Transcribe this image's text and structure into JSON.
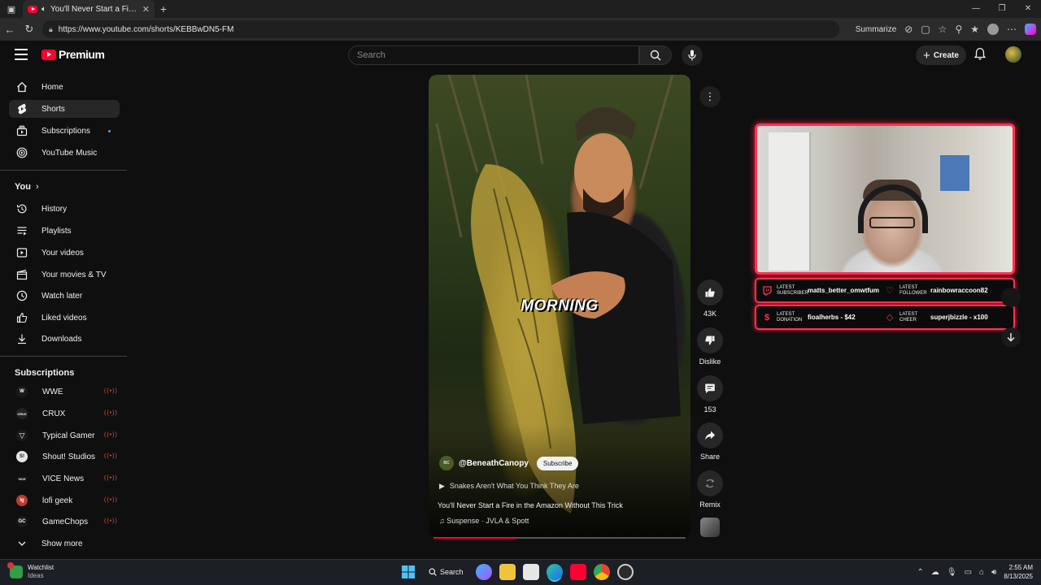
{
  "browser": {
    "tab_title": "You'll Never Start a Fire in th",
    "url": "https://www.youtube.com/shorts/KEBBwDN5-FM",
    "summarize_label": "Summarize"
  },
  "header": {
    "logo_text": "Premium",
    "search_placeholder": "Search",
    "create_label": "Create"
  },
  "sidebar": {
    "main": [
      {
        "label": "Home",
        "icon": "home-icon"
      },
      {
        "label": "Shorts",
        "icon": "shorts-icon",
        "active": true
      },
      {
        "label": "Subscriptions",
        "icon": "subscriptions-icon"
      },
      {
        "label": "YouTube Music",
        "icon": "youtube-music-icon"
      }
    ],
    "you_heading": "You",
    "you": [
      {
        "label": "History",
        "icon": "history-icon"
      },
      {
        "label": "Playlists",
        "icon": "playlists-icon"
      },
      {
        "label": "Your videos",
        "icon": "your-videos-icon"
      },
      {
        "label": "Your movies & TV",
        "icon": "movies-icon"
      },
      {
        "label": "Watch later",
        "icon": "watch-later-icon"
      },
      {
        "label": "Liked videos",
        "icon": "liked-icon"
      },
      {
        "label": "Downloads",
        "icon": "download-icon"
      }
    ],
    "subs_heading": "Subscriptions",
    "subs": [
      {
        "label": "WWE",
        "badge": "W",
        "color": "#1a1a1a"
      },
      {
        "label": "CRUX",
        "badge": "CRUX",
        "color": "#222222"
      },
      {
        "label": "Typical Gamer",
        "badge": "▽",
        "color": "#1a1a1a"
      },
      {
        "label": "Shout! Studios",
        "badge": "S!",
        "color": "#e6e6e6"
      },
      {
        "label": "VICE News",
        "badge": "VICE",
        "color": "#111111"
      },
      {
        "label": "lofi geek",
        "badge": "lg",
        "color": "#c0392b"
      },
      {
        "label": "GameChops",
        "badge": "GC",
        "color": "#1a1a1a"
      }
    ],
    "show_more": "Show more"
  },
  "short": {
    "caption": "MORNING",
    "channel": "@BeneathCanopy",
    "subscribe": "Subscribe",
    "playlist": "Snakes Aren't What You Think They Are",
    "title": "You'll Never Start a Fire in the Amazon Without This Trick",
    "sound": "Suspense · JVLA & Spott",
    "progress": 0.33,
    "likes": "43K",
    "dislike_label": "Dislike",
    "comments": "153",
    "share_label": "Share",
    "remix_label": "Remix"
  },
  "stream_overlay": {
    "accent": "#ff3150",
    "row1": [
      {
        "key1": "LATEST",
        "key2": "SUBSCRIBER",
        "value": "matts_better_omwtfum",
        "icon": "twitch-icon"
      },
      {
        "key1": "LATEST",
        "key2": "FOLLOWER",
        "value": "rainbowraccoon82",
        "icon": "heart-icon"
      }
    ],
    "row2": [
      {
        "key1": "LATEST",
        "key2": "DONATION",
        "value": "fioalherbs - $42",
        "icon": "dollar-icon"
      },
      {
        "key1": "LATEST",
        "key2": "CHEER",
        "value": "superjbizzle - x100",
        "icon": "diamond-icon"
      }
    ]
  },
  "taskbar": {
    "weather_title": "Watchlist",
    "weather_sub": "Ideas",
    "search_label": "Search",
    "time": "2:55 AM",
    "date": "8/13/2025"
  }
}
